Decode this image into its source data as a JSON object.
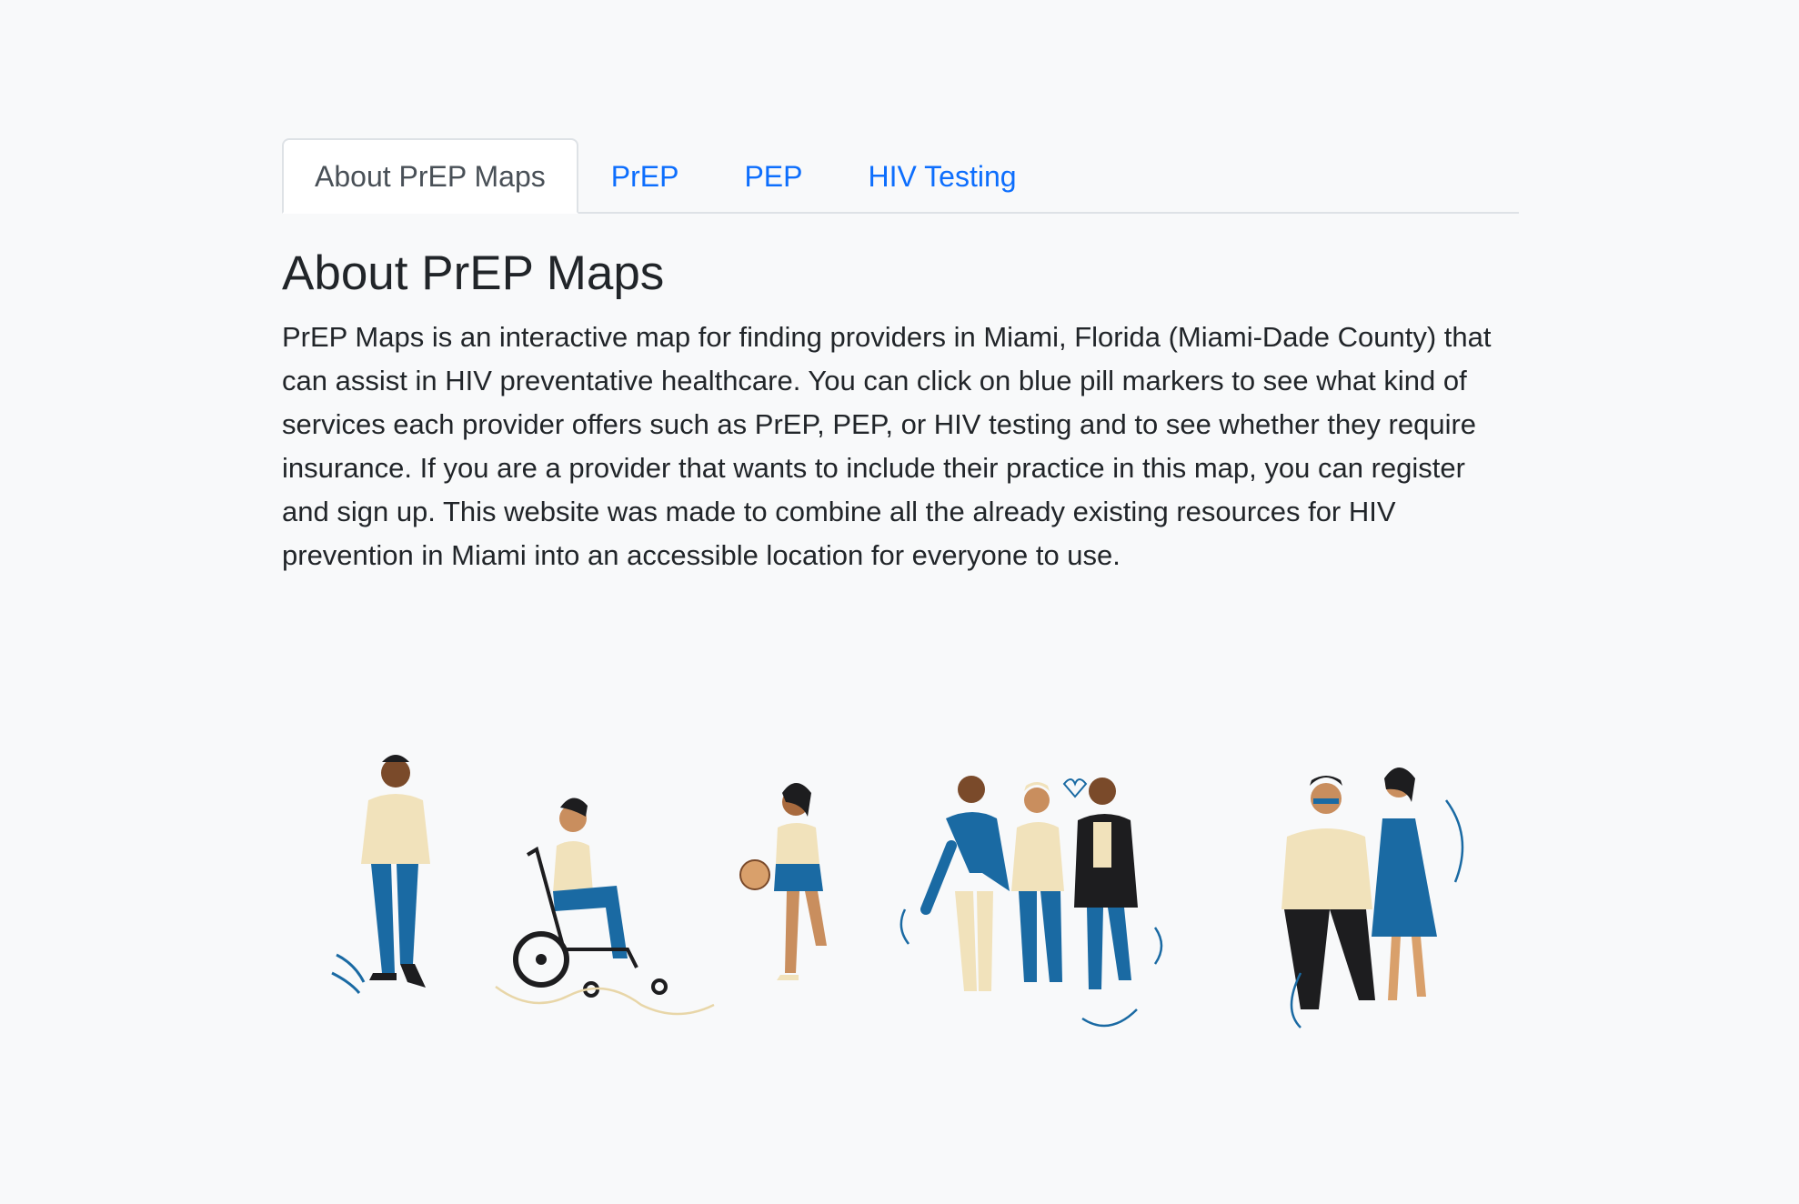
{
  "tabs": [
    {
      "label": "About PrEP Maps",
      "active": true
    },
    {
      "label": "PrEP",
      "active": false
    },
    {
      "label": "PEP",
      "active": false
    },
    {
      "label": "HIV Testing",
      "active": false
    }
  ],
  "about": {
    "title": "About PrEP Maps",
    "body": "PrEP Maps is an interactive map for finding providers in Miami, Florida (Miami-Dade County) that can assist in HIV preventative healthcare. You can click on blue pill markers to see what kind of services each provider offers such as PrEP, PEP, or HIV testing and to see whether they require insurance. If you are a provider that wants to include their practice in this map, you can register and sign up. This website was made to combine all the already existing resources for HIV prevention in Miami into an accessible location for everyone to use."
  },
  "colors": {
    "background": "#f8f9fa",
    "link": "#0d6efd",
    "illustration_blue": "#1a6aa3",
    "illustration_cream": "#f1e2bb",
    "illustration_black": "#1d1d1f"
  }
}
